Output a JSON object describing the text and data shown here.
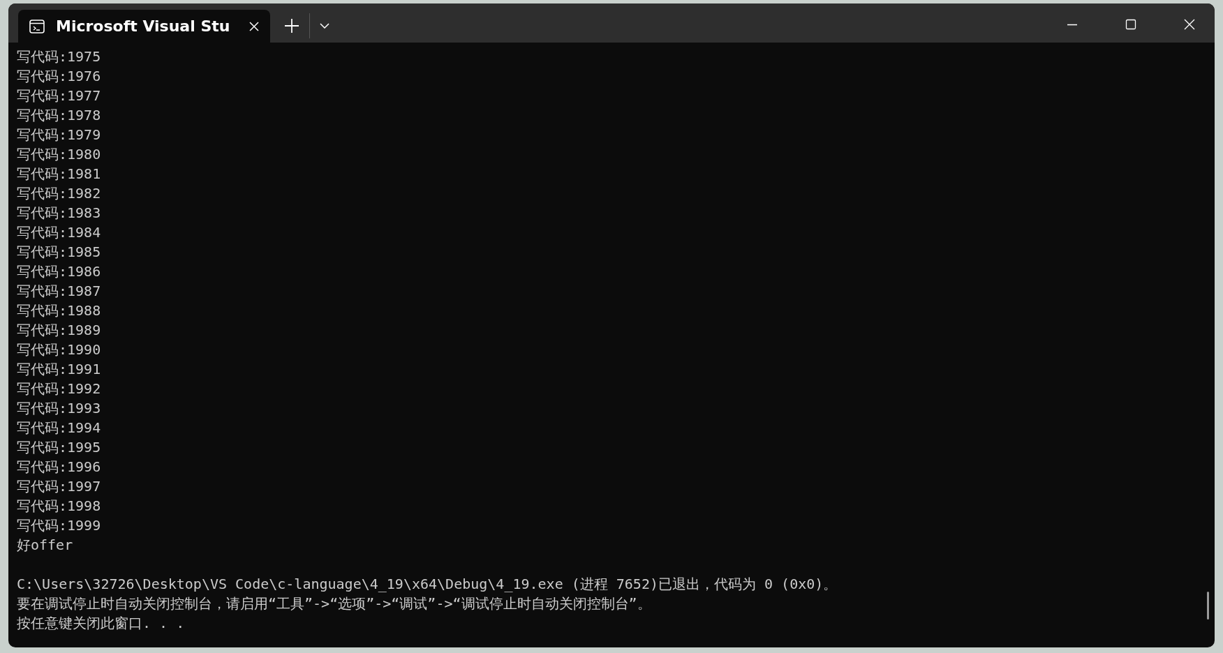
{
  "window": {
    "title": "Microsoft Visual Stu"
  },
  "console": {
    "lines": [
      "写代码:1975",
      "写代码:1976",
      "写代码:1977",
      "写代码:1978",
      "写代码:1979",
      "写代码:1980",
      "写代码:1981",
      "写代码:1982",
      "写代码:1983",
      "写代码:1984",
      "写代码:1985",
      "写代码:1986",
      "写代码:1987",
      "写代码:1988",
      "写代码:1989",
      "写代码:1990",
      "写代码:1991",
      "写代码:1992",
      "写代码:1993",
      "写代码:1994",
      "写代码:1995",
      "写代码:1996",
      "写代码:1997",
      "写代码:1998",
      "写代码:1999",
      "好offer"
    ],
    "exit_lines": [
      "C:\\Users\\32726\\Desktop\\VS Code\\c-language\\4_19\\x64\\Debug\\4_19.exe (进程 7652)已退出，代码为 0 (0x0)。",
      "要在调试停止时自动关闭控制台，请启用“工具”->“选项”->“调试”->“调试停止时自动关闭控制台”。",
      "按任意键关闭此窗口. . ."
    ]
  }
}
